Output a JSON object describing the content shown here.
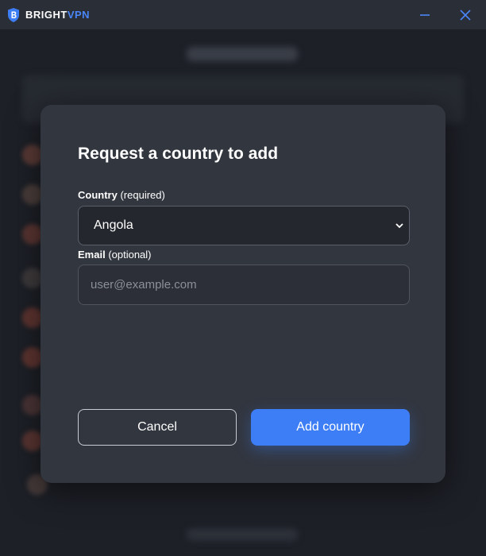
{
  "app": {
    "brand_bright": "BRIGHT",
    "brand_vpn": "VPN",
    "icons": {
      "logo": "shield-b-logo",
      "minimize": "minimize-icon",
      "close": "close-icon"
    },
    "accent_color": "#3d7ef6"
  },
  "modal": {
    "title": "Request a country to add",
    "country_label": "Country",
    "country_hint": "(required)",
    "country_value": "Angola",
    "email_label": "Email",
    "email_hint": "(optional)",
    "email_value": "",
    "email_placeholder": "user@example.com",
    "cancel_label": "Cancel",
    "add_label": "Add country"
  }
}
